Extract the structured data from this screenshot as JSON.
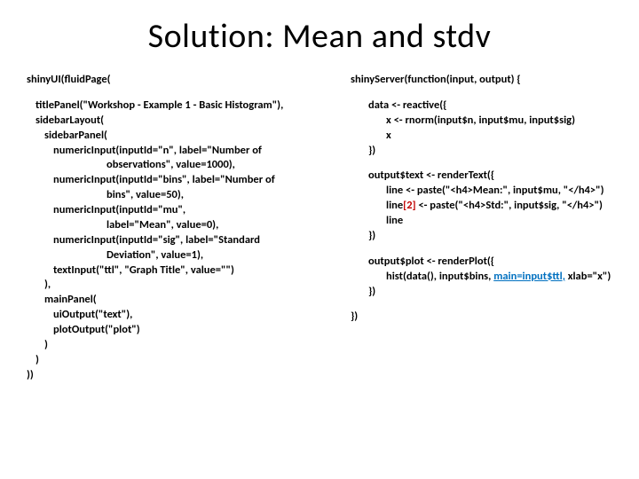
{
  "title": {
    "solution_word": "Solution",
    "rest": ": Mean and stdv"
  },
  "left": {
    "l1": "shinyUI(fluidPage(",
    "l2a": "titlePanel(\"Workshop - ",
    "l2b": "Example 1 ",
    "l2c": "- Basic Histogram\"),",
    "l3": "sidebarLayout(",
    "l4": "sidebarPanel(",
    "l5": "numericInput(inputId=\"n\", label=\"Number of",
    "l5b": "observations\", value=1000),",
    "l6": "numericInput(inputId=\"bins\", label=\"Number of",
    "l6b": "bins\", value=50),",
    "l7": "numericInput(inputId=\"mu\",",
    "l7b": "label=\"Mean\", value=0),",
    "l8": "numericInput(inputId=\"sig\", label=\"Standard",
    "l8b": "Deviation\", value=1),",
    "l9": "textInput(\"ttl\", \"Graph Title\", value=\"\")",
    "l10": "),",
    "l11": "mainPanel(",
    "l12": "uiOutput(\"text\"),",
    "l13": "plotOutput(\"plot\")",
    "l14": ")",
    "l15": ")",
    "l16": "))"
  },
  "right": {
    "r1": "shinyServer(function(input, output) {",
    "r2": "data <- reactive({",
    "r3a": "x <- rnorm(input$n, input$mu",
    "r3b": ", input$sig",
    "r3c": ")",
    "r4": "x",
    "r5": "})",
    "r6": "output$text <- renderText({",
    "r7a": "line <- paste(\"<h4>Mean:\", input$mu, \"</h4>\")",
    "r8a": "line",
    "r8red": "[2]",
    "r8b": " <- paste(\"<h4>Std:\", input$sig, \"</h4>\")",
    "r9": "line",
    "r10": "})",
    "r11": "output$plot <- renderPlot({",
    "r12a": "hist(data(), input$bins, ",
    "r12blue": "main=input$ttl,",
    "r12b": " xlab=\"x\")",
    "r13": "})",
    "r14": "})"
  }
}
